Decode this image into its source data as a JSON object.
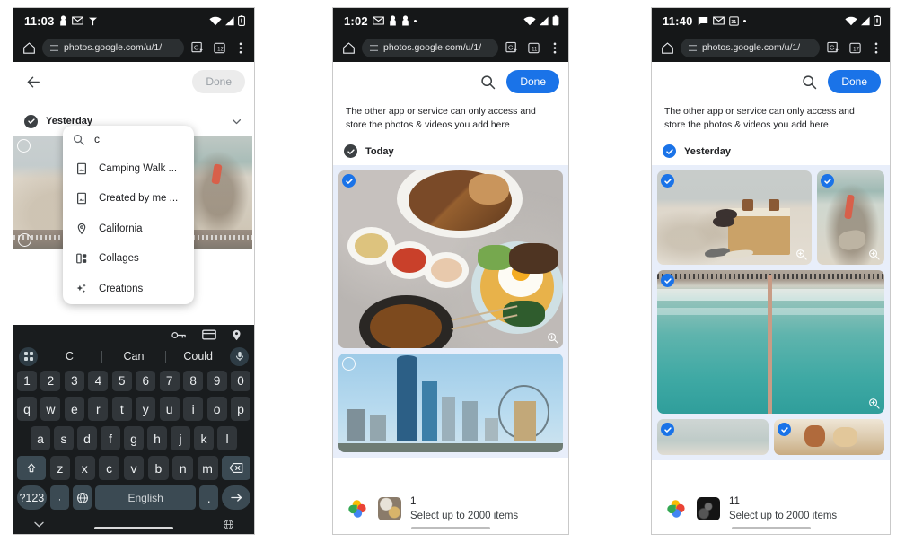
{
  "colors": {
    "accent": "#1a73e8",
    "dark_bar": "#151718",
    "grid_bg": "#e8eefa",
    "disabled": "#ececec"
  },
  "phones": [
    {
      "id": "phone-1",
      "status": {
        "time": "11:03",
        "icons": [
          "person-icon",
          "gmail-icon",
          "antenna-icon"
        ],
        "right_icons": [
          "wifi-icon",
          "signal-icon",
          "battery-icon"
        ]
      },
      "browser": {
        "home_icon": "home-icon",
        "url": "photos.google.com/u/1/",
        "translate_icon": "translate-icon",
        "calendar_icon": "calendar-icon",
        "menu_icon": "overflow-menu-icon"
      },
      "app": {
        "back_icon": "back-arrow-icon",
        "done_label": "Done",
        "done_disabled": true,
        "section": {
          "label": "Yesterday",
          "checked": "dark",
          "chevron": true
        }
      },
      "search_dropdown": {
        "query": "c",
        "search_icon": "search-icon",
        "items": [
          {
            "icon": "photo-album-icon",
            "label": "Camping Walk ..."
          },
          {
            "icon": "photo-album-icon",
            "label": "Created by me ..."
          },
          {
            "icon": "location-pin-icon",
            "label": "California"
          },
          {
            "icon": "collage-icon",
            "label": "Collages"
          },
          {
            "icon": "sparkle-icon",
            "label": "Creations"
          }
        ]
      },
      "keyboard": {
        "accessory_icons": [
          "password-key-icon",
          "payment-card-icon",
          "address-pin-icon"
        ],
        "grid_icon": "keyboard-grid-icon",
        "mic_icon": "microphone-icon",
        "suggestions": [
          "C",
          "Can",
          "Could"
        ],
        "row_numbers": [
          "1",
          "2",
          "3",
          "4",
          "5",
          "6",
          "7",
          "8",
          "9",
          "0"
        ],
        "row_top": [
          "q",
          "w",
          "e",
          "r",
          "t",
          "y",
          "u",
          "i",
          "o",
          "p"
        ],
        "row_home": [
          "a",
          "s",
          "d",
          "f",
          "g",
          "h",
          "j",
          "k",
          "l"
        ],
        "row_bottom": [
          "z",
          "x",
          "c",
          "v",
          "b",
          "n",
          "m"
        ],
        "shift_icon": "shift-up-icon",
        "backspace_icon": "backspace-icon",
        "symbols_label": "?123",
        "comma_label": ",",
        "emoji_label": "☺",
        "globe_icon": "language-globe-icon",
        "space_label": "English",
        "period_label": ".",
        "enter_icon": "enter-arrow-icon",
        "nav_collapse_icon": "chevron-down-icon",
        "nav_globe_icon": "language-globe-icon"
      }
    },
    {
      "id": "phone-2",
      "status": {
        "time": "1:02",
        "icons": [
          "gmail-icon",
          "person-icon",
          "person-icon",
          "dot-icon"
        ],
        "right_icons": [
          "wifi-icon",
          "signal-icon",
          "battery-full-icon"
        ]
      },
      "browser": {
        "home_icon": "home-icon",
        "url": "photos.google.com/u/1/",
        "translate_icon": "translate-icon",
        "calendar_icon": "calendar-icon",
        "menu_icon": "overflow-menu-icon"
      },
      "app": {
        "search_icon": "search-icon",
        "done_label": "Done",
        "done_disabled": false,
        "notice": "The other app or service can only access and store the photos & videos you add here",
        "section": {
          "label": "Today",
          "checked": "dark",
          "chevron": false
        },
        "photos": [
          {
            "name": "korean-food-spread",
            "selected": true,
            "zoom_icon": "zoom-in-icon"
          },
          {
            "name": "city-skyline-ferris-wheel",
            "selected": false,
            "zoom_icon": null
          }
        ]
      },
      "bottom": {
        "app_icon": "google-photos-icon",
        "thumb": "korean-food-thumb",
        "count": "1",
        "hint": "Select up to 2000 items"
      }
    },
    {
      "id": "phone-3",
      "status": {
        "time": "11:40",
        "icons": [
          "message-icon",
          "gmail-icon",
          "calendar-icon",
          "dot-icon"
        ],
        "right_icons": [
          "wifi-icon",
          "signal-icon",
          "battery-icon"
        ]
      },
      "browser": {
        "home_icon": "home-icon",
        "url": "photos.google.com/u/1/",
        "translate_icon": "translate-icon",
        "calendar_icon": "calendar-icon",
        "menu_icon": "overflow-menu-icon"
      },
      "app": {
        "search_icon": "search-icon",
        "done_label": "Done",
        "done_disabled": false,
        "notice": "The other app or service can only access and store the photos & videos you add here",
        "section": {
          "label": "Yesterday",
          "checked": "blue",
          "chevron": false
        },
        "photos": [
          {
            "name": "beach-bag-sandals",
            "selected": true,
            "zoom_icon": "zoom-in-icon"
          },
          {
            "name": "beach-rocks-towel",
            "selected": true,
            "zoom_icon": "zoom-in-icon"
          },
          {
            "name": "aerial-turquoise-pier",
            "selected": true,
            "zoom_icon": "zoom-in-icon"
          },
          {
            "name": "partial-photo-left",
            "selected": true,
            "zoom_icon": null
          },
          {
            "name": "partial-photo-right",
            "selected": true,
            "zoom_icon": null
          }
        ]
      },
      "bottom": {
        "app_icon": "google-photos-icon",
        "thumb": "dark-night-thumb",
        "count": "11",
        "hint": "Select up to 2000 items"
      }
    }
  ]
}
